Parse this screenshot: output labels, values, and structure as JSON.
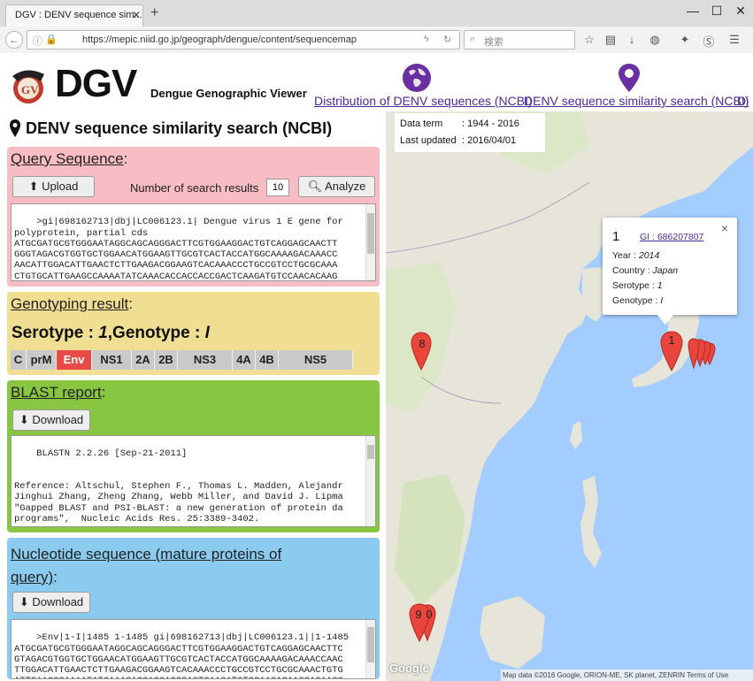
{
  "browser": {
    "tab_title": "DGV : DENV sequence sim...",
    "tab_close": "✕",
    "new_tab": "+",
    "minimize": "—",
    "maximize": "☐",
    "close": "✕",
    "url": "https://mepic.niid.go.jp/geograph/dengue/content/sequencemap",
    "search_placeholder": "検索"
  },
  "header": {
    "logo_text": "DGV",
    "logo_subtitle": "Dengue Genographic Viewer",
    "link_distribution": "Distribution of DENV sequences (NCBI)",
    "link_similarity": "DENV sequence similarity search (NCBI)",
    "link_cut": "Di"
  },
  "page": {
    "title": "DENV sequence similarity search (NCBI)"
  },
  "query": {
    "title": "Query Sequence",
    "title_suffix": ":",
    "upload_label": "Upload",
    "num_results_label": "Number of search results",
    "num_results_value": "10",
    "analyze_label": "Analyze",
    "sequence_text": ">gi|698162713|dbj|LC006123.1| Dengue virus 1 E gene for\npolyprotein, partial cds\nATGCGATGCGTGGGAATAGGCAGCAGGGACTTCGTGGAAGGACTGTCAGGAGCAACTT\nGGGTAGACGTGGTGCTGGAACATGGAAGTTGCGTCACTACCATGGCAAAAGACAAACC\nAACATTGGACATTGAACTCTTGAAGACGGAAGTCACAAACCCTGCCGTCCTGCGCAAA\nCTGTGCATTGAAGCCAAAATATCAAACACCACCACCGACTCAAGATGTCCAACACAAG\nGAGAAGCCACACTGGTGGAAGAACAAGACGCGAACTTTGTGTGTCGACGAACGTTTGT"
  },
  "genotyping": {
    "title": "Genotyping result",
    "title_suffix": ":",
    "serotype_label": "Serotype : ",
    "serotype_value": "1",
    "genotype_label": ",Genotype : ",
    "genotype_value": "I",
    "genes": [
      {
        "label": "C",
        "active": false
      },
      {
        "label": "prM",
        "active": false
      },
      {
        "label": "Env",
        "active": true
      },
      {
        "label": "NS1",
        "active": false
      },
      {
        "label": "2A",
        "active": false
      },
      {
        "label": "2B",
        "active": false
      },
      {
        "label": "NS3",
        "active": false
      },
      {
        "label": "4A",
        "active": false
      },
      {
        "label": "4B",
        "active": false
      },
      {
        "label": "NS5",
        "active": false
      }
    ]
  },
  "blast": {
    "title": "BLAST report",
    "title_suffix": ":",
    "download_label": "Download",
    "report_text": "BLASTN 2.2.26 [Sep-21-2011]\n\n\nReference: Altschul, Stephen F., Thomas L. Madden, Alejandr\nJinghui Zhang, Zheng Zhang, Webb Miller, and David J. Lipma\n\"Gapped BLAST and PSI-BLAST: a new generation of protein da\nprograms\",  Nucleic Acids Res. 25:3389-3402."
  },
  "nucleotide": {
    "title_line1": "Nucleotide sequence (mature proteins of",
    "title_line2": "query)",
    "title_suffix": ":",
    "download_label": "Download",
    "sequence_text": ">Env|1-I|1485 1-1485 gi|698162713|dbj|LC006123.1||1-1485\nATGCGATGCGTGGGAATAGGCAGCAGGGACTTCGTGGAAGGACTGTCAGGAGCAACTTC\nGTAGACGTGGTGCTGGAACATGGAAGTTGCGTCACTACCATGGCAAAAGACAAACCAAC\nTTGGACATTGAACTCTTGAAGACGGAAGTCACAAACCCTGCCGTCCTGCGCAAACTGTG\nATTGAAGCCAAAATATCAAACACCACCACCGACTCAAGATGTCCAACACAAGGAGAAGC"
  },
  "map": {
    "data_term_label": "Data term",
    "data_term_value": ": 1944 - 2016",
    "last_updated_label": "Last updated",
    "last_updated_value": ": 2016/04/01",
    "popup": {
      "number": "1",
      "gi_link": "GI : 686207807",
      "close": "×",
      "year_label": "Year : ",
      "year_value": "2014",
      "country_label": "Country : ",
      "country_value": "Japan",
      "serotype_label": "Serotype : ",
      "serotype_value": "1",
      "genotype_label": "Genotype : ",
      "genotype_value": "I"
    },
    "markers": [
      {
        "label": "8"
      },
      {
        "label": "1"
      },
      {
        "label": "9"
      },
      {
        "label": "0"
      }
    ],
    "attribution": "Map data ©2016 Google, ORION-ME, SK planet, ZENRIN   Terms of Use",
    "google": "Google"
  },
  "colors": {
    "query_bg": "#f7bcc4",
    "genotyping_bg": "#f0df93",
    "blast_bg": "#88c641",
    "nucleotide_bg": "#8ccbf0",
    "active_gene": "#e84a47",
    "link": "#4b2a9a",
    "marker": "#e8453c",
    "sea": "#a3ccff",
    "land": "#e8e6df"
  }
}
